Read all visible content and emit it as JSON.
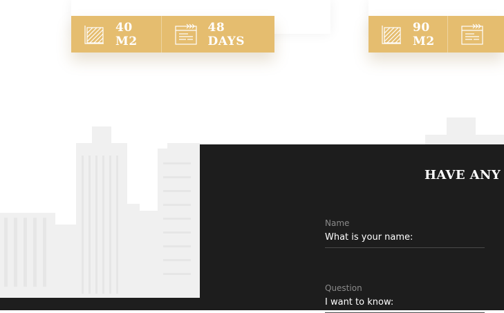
{
  "colors": {
    "accent": "#e5bd6f",
    "panel": "#1d1d1d",
    "skyline": "#eeeeee"
  },
  "cards": [
    {
      "stats": [
        {
          "icon": "area-icon",
          "value": "40 M2"
        },
        {
          "icon": "calendar-icon",
          "value": "48 DAYS"
        }
      ]
    },
    {
      "stats": [
        {
          "icon": "area-icon",
          "value": "90 M2"
        },
        {
          "icon": "calendar-icon",
          "value": ""
        }
      ]
    }
  ],
  "contact": {
    "title": "HAVE ANY Q",
    "fields": [
      {
        "label": "Name",
        "placeholder": "What is your name:"
      },
      {
        "label": "Question",
        "placeholder": "I want to know:"
      }
    ]
  }
}
